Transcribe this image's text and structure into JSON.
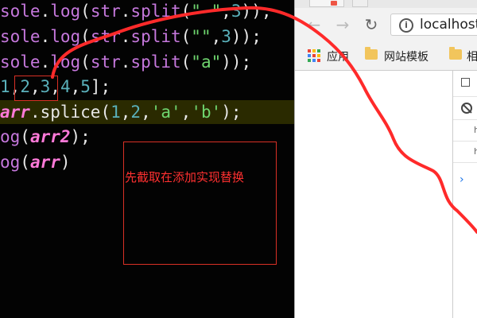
{
  "editor": {
    "lines": [
      {
        "prefix": "sole",
        "dot": ".",
        "fn": "log",
        "open": "(",
        "arg": "str",
        "dot2": ".",
        "method": "split",
        "paren": "(",
        "str": "\" \"",
        "comma": ",",
        "num": "3",
        "close": "));"
      },
      {
        "prefix": "sole",
        "dot": ".",
        "fn": "log",
        "open": "(",
        "arg": "str",
        "dot2": ".",
        "method": "split",
        "paren": "(",
        "str": "\"\"",
        "comma": ",",
        "num": "3",
        "close": "));"
      },
      {
        "prefix": "sole",
        "dot": ".",
        "fn": "log",
        "open": "(",
        "arg": "str",
        "dot2": ".",
        "method": "split",
        "paren": "(",
        "str": "\"a\"",
        "close": "));"
      }
    ],
    "array_line": {
      "n1": "1",
      "c1": ",",
      "n2": "2",
      "c2": ",",
      "n3": "3",
      "c3": ",",
      "n4": "4",
      "c4": ",",
      "n5": "5",
      "end": "];"
    },
    "splice_line": {
      "var": "arr",
      "dot": ".",
      "method": "splice",
      "open": "(",
      "a1": "1",
      "c1": ",",
      "a2": "2",
      "c2": ",",
      "a3": "'a'",
      "c3": ",",
      "a4": "'b'",
      "close": ");"
    },
    "log_arr2": {
      "prefix": "og",
      "open": "(",
      "var": "arr2",
      "close": ");"
    },
    "log_arr": {
      "prefix": "og",
      "open": "(",
      "var": "arr",
      "close": ")"
    }
  },
  "annotation": {
    "text": "先截取在添加实现替换",
    "color": "#ff3030"
  },
  "browser": {
    "url": "localhost",
    "bookmarks": [
      {
        "label": "应用",
        "icon": "apps-grid-icon"
      },
      {
        "label": "网站模板",
        "icon": "folder-icon"
      },
      {
        "label": "相",
        "icon": "folder-icon"
      }
    ],
    "devtools": {
      "rows": [
        "h",
        "h"
      ]
    }
  },
  "colors": {
    "stroke": "#ff2a2a",
    "accent": "#1a73e8"
  }
}
